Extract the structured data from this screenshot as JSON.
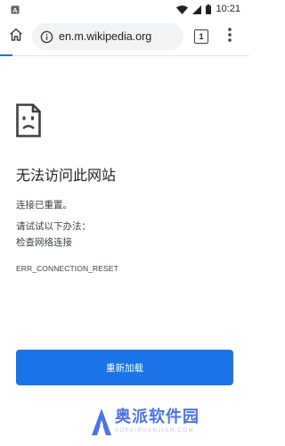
{
  "status_bar": {
    "time": "10:21",
    "notification_icon": "a-letter-icon",
    "wifi_icon": "wifi-icon",
    "signal_icon": "signal-icon",
    "battery_icon": "battery-icon"
  },
  "toolbar": {
    "home_icon": "home-icon",
    "site_info_icon": "info-icon",
    "url": "en.m.wikipedia.org",
    "tab_count": "1",
    "menu_icon": "more-vert-icon"
  },
  "error": {
    "icon": "sad-page-icon",
    "title": "无法访问此网站",
    "message": "连接已重置。",
    "suggestions_heading": "请试试以下办法：",
    "suggestion_1": "检查网络连接",
    "code": "ERR_CONNECTION_RESET",
    "reload_label": "重新加载"
  },
  "watermark": {
    "name": "奥派软件园",
    "url": "AOPAIRUANJIAN.COM"
  },
  "colors": {
    "accent": "#1a73e8",
    "omnibox_bg": "#f1f3f4",
    "text": "#202124",
    "watermark": "#4a74e8"
  }
}
